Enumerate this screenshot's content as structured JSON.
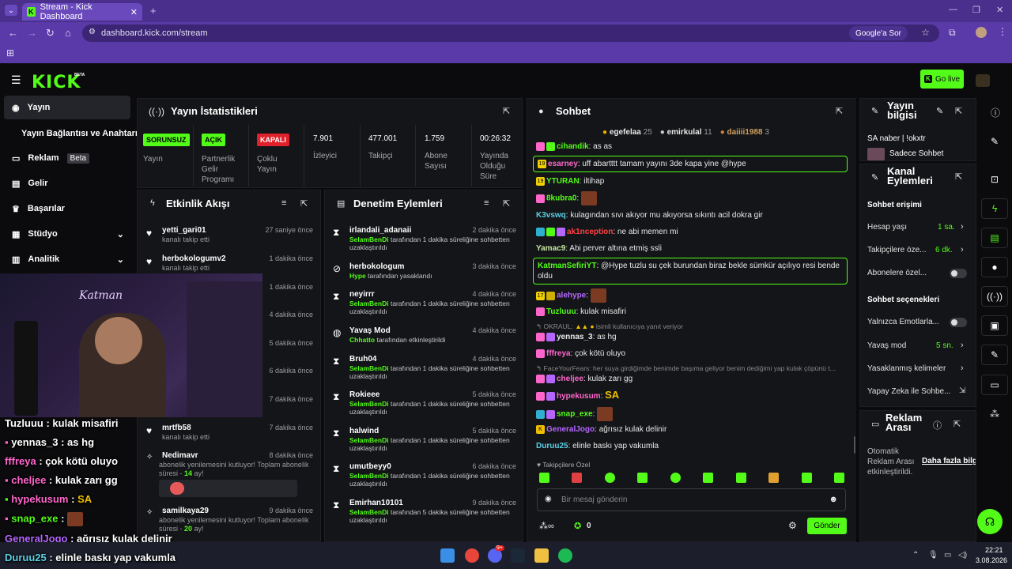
{
  "browser": {
    "tab_title": "Stream - Kick Dashboard",
    "url": "dashboard.kick.com/stream",
    "ask_google": "Google'a Sor"
  },
  "header": {
    "logo": "KICK",
    "logo_badge": "BETA",
    "go_live": "Go live"
  },
  "sidebar": {
    "items": [
      {
        "label": "Yayın"
      },
      {
        "label": "Yayın Bağlantısı ve Anahtarı"
      },
      {
        "label": "Reklam",
        "badge": "Beta"
      },
      {
        "label": "Gelir"
      },
      {
        "label": "Başarılar"
      },
      {
        "label": "Stüdyo"
      },
      {
        "label": "Analitik"
      }
    ]
  },
  "stats": {
    "title": "Yayın İstatistikleri",
    "items": [
      {
        "badge": "SORUNSUZ",
        "label": "Yayın"
      },
      {
        "badge": "AÇIK",
        "label": "Partnerlik Gelir Programı"
      },
      {
        "badge": "KAPALI",
        "label": "Çoklu Yayın"
      },
      {
        "value": "7.901",
        "label": "İzleyici"
      },
      {
        "value": "477.001",
        "label": "Takipçi"
      },
      {
        "value": "1.759",
        "label": "Abone Sayısı"
      },
      {
        "value": "00:26:32",
        "label": "Yayında Olduğu Süre"
      }
    ]
  },
  "activity": {
    "title": "Etkinlik Akışı",
    "rows": [
      {
        "name": "yetti_gari01",
        "sub": "kanalı takip etti",
        "time": "27 saniye önce"
      },
      {
        "name": "herbokologumv2",
        "sub": "kanalı takip etti",
        "time": "1 dakika önce"
      },
      {
        "time": "1 dakika önce"
      },
      {
        "time": "4 dakika önce"
      },
      {
        "time": "5 dakika önce"
      },
      {
        "time": "6 dakika önce"
      },
      {
        "time": "7 dakika önce"
      },
      {
        "name": "mrtfb58",
        "sub": "kanalı takip etti",
        "time": "7 dakika önce"
      },
      {
        "name": "Nedimavr",
        "sub1": "abonelik yenilemesini kutluyor! Toplam abonelik süresi - ",
        "months": "14",
        "sub2": " ay!",
        "time": "8 dakika önce"
      },
      {
        "name": "samilkaya29",
        "sub1": "abonelik yenilemesini kutluyor! Toplam abonelik süresi - ",
        "months": "20",
        "sub2": " ay!",
        "time": "9 dakika önce"
      }
    ]
  },
  "moderation": {
    "title": "Denetim Eylemleri",
    "rows": [
      {
        "name": "irlandali_adanaii",
        "actor": "SelamBenDi",
        "text": " tarafından 1 dakika süreliğine sohbetten uzaklaştırıldı",
        "time": "2 dakika önce"
      },
      {
        "name": "herbokologum",
        "actor": "Hype",
        "text": " tarafından yasaklandı",
        "time": "3 dakika önce"
      },
      {
        "name": "neyirrr",
        "actor": "SelamBenDi",
        "text": " tarafından 1 dakika süreliğine sohbetten uzaklaştırıldı",
        "time": "4 dakika önce"
      },
      {
        "name": "Yavaş Mod",
        "actor": "Chhatto",
        "text": " tarafından etkinleştirildi",
        "time": "4 dakika önce"
      },
      {
        "name": "Bruh04",
        "actor": "SelamBenDi",
        "text": " tarafından 1 dakika süreliğine sohbetten uzaklaştırıldı",
        "time": "4 dakika önce"
      },
      {
        "name": "Rokieee",
        "actor": "SelamBenDi",
        "text": " tarafından 1 dakika süreliğine sohbetten uzaklaştırıldı",
        "time": "5 dakika önce"
      },
      {
        "name": "halwind",
        "actor": "SelamBenDi",
        "text": " tarafından 1 dakika süreliğine sohbetten uzaklaştırıldı",
        "time": "5 dakika önce"
      },
      {
        "name": "umutbeyy0",
        "actor": "SelamBenDi",
        "text": " tarafından 1 dakika süreliğine sohbetten uzaklaştırıldı",
        "time": "6 dakika önce"
      },
      {
        "name": "Emirhan10101",
        "actor": "SelamBenDi",
        "text": " tarafından 5 dakika süreliğine sohbetten uzaklaştırıldı",
        "time": "9 dakika önce"
      }
    ]
  },
  "chat": {
    "title": "Sohbet",
    "top_gifters": [
      {
        "name": "egefelaa",
        "count": "25"
      },
      {
        "name": "emirkulal",
        "count": "11"
      },
      {
        "name": "daiiii1988",
        "count": "3"
      }
    ],
    "messages": [
      {
        "user": "cihandik",
        "color": "#53fc18",
        "text": ": as as"
      },
      {
        "user": "esarney",
        "color": "#ff66cc",
        "text": ": uff abartttt tamam yayını 3de kapa yine @hype",
        "highlight": true
      },
      {
        "user": "YTURAN",
        "color": "#53fc18",
        "text": ": iltihap"
      },
      {
        "user": "8kubra0",
        "color": "#53fc18",
        "text": ":"
      },
      {
        "user": "K3vswq",
        "color": "#5ad0e6",
        "text": ": kulagından sıvı akıyor mu akıyorsa sıkıntı acil dokra gir"
      },
      {
        "user": "ak1nception",
        "color": "#ff4444",
        "text": ": ne abi memen mi"
      },
      {
        "user": "Yamac9",
        "color": "#c8e6a0",
        "text": ": Abi perver altına etmiş ssli"
      },
      {
        "user": "KatmanSefiriYT",
        "color": "#53fc18",
        "text": ": @Hype tuzlu su çek burundan biraz bekle sümkür açılıyo resi bende oldu",
        "highlight": true
      },
      {
        "user": "alehype",
        "color": "#b566ff",
        "text": ":"
      },
      {
        "user": "Tuzluuu",
        "color": "#53fc18",
        "text": ": kulak misafiri"
      },
      {
        "reply": "OKRAUL:",
        "reply_rest": " isimli kullanıcıya yanıt veriyor"
      },
      {
        "user": "yennas_3",
        "color": "#e8e8e8",
        "text": ": as hg"
      },
      {
        "user": "fffreya",
        "color": "#ff66cc",
        "text": ": çok kötü oluyo"
      },
      {
        "reply": "FaceYourFears: her suya girdiğimde benimde başıma geliyor benim dediğimi yap kulak çöpünü t..."
      },
      {
        "user": "cheljee",
        "color": "#ff66cc",
        "text": ": kulak zarı gg"
      },
      {
        "user": "hypekusum",
        "color": "#ff66cc",
        "text": ":"
      },
      {
        "user": "snap_exe",
        "color": "#53fc18",
        "text": ":"
      },
      {
        "user": "GeneralJogo",
        "color": "#b566ff",
        "text": ": ağrısız kulak delinir"
      },
      {
        "user": "Duruu25",
        "color": "#5ad0e6",
        "text": ": elinle baskı yap vakumla"
      }
    ],
    "followers_only": "Takipçilere Özel",
    "input_placeholder": "Bir mesaj gönderin",
    "points": "0",
    "send": "Gönder"
  },
  "stream_info": {
    "title": "Yayın bilgisi",
    "stream_title": "SA naber | !okxtr",
    "category": "Sadece Sohbet"
  },
  "channel_actions": {
    "title": "Kanal Eylemleri",
    "chat_access": "Sohbet erişimi",
    "account_age": "Hesap yaşı",
    "account_age_val": "1 sa.",
    "followers_only": "Takipçilere öze...",
    "followers_only_val": "6 dk.",
    "subs_only": "Abonelere özel...",
    "chat_options": "Sohbet seçenekleri",
    "emotes_only": "Yalnızca Emotlarla...",
    "slow_mode": "Yavaş mod",
    "slow_mode_val": "5 sn.",
    "banned_words": "Yasaklanmış kelimeler",
    "ai_chat": "Yapay Zeka ile Sohbe..."
  },
  "ad_break": {
    "title": "Reklam Arası",
    "text": "Otomatik Reklam Arası etkinleştirildi.",
    "link": "Daha fazla bilgi"
  },
  "overlay_chat": [
    {
      "user": "Tuzluuu",
      "text": " : kulak misafiri"
    },
    {
      "user": "yennas_3",
      "text": " : as hg"
    },
    {
      "user": "fffreya",
      "text": " : çok kötü oluyo"
    },
    {
      "user": "cheljee",
      "text": " : kulak zarı gg"
    },
    {
      "user": "hypekusum",
      "text": " :"
    },
    {
      "user": "snap_exe",
      "text": " :"
    },
    {
      "user": "GeneralJogo",
      "text": " : ağrısız kulak delinir"
    },
    {
      "user": "Duruu25",
      "text": " : elinle baskı yap vakumla"
    }
  ],
  "taskbar": {
    "time": "22:21",
    "date": "3.08.2026",
    "discord_badge": "9+"
  },
  "colors": {
    "accent": "#53fc18",
    "browser": "#5a3aa8"
  }
}
